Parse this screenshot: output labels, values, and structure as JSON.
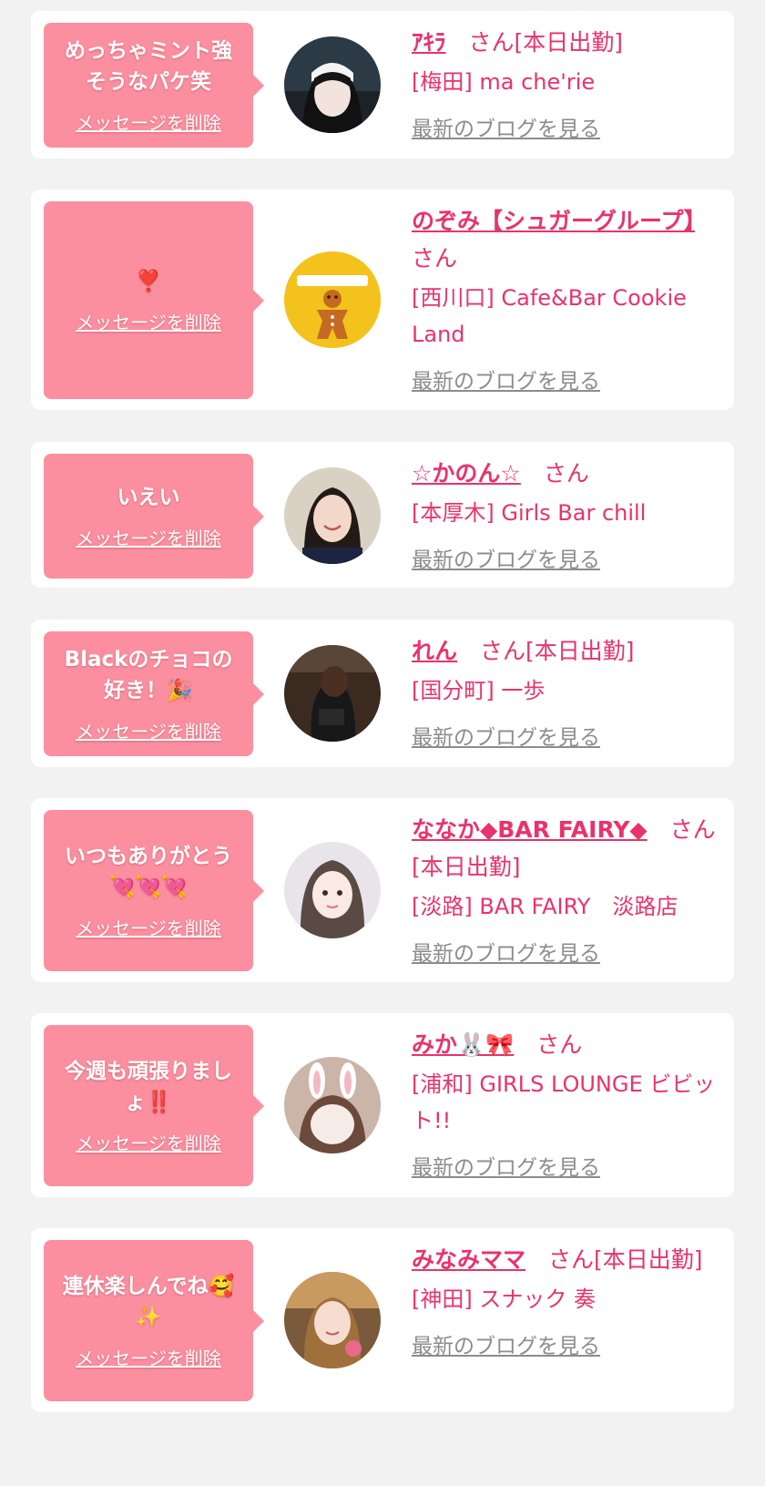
{
  "colors": {
    "background": "#f2f2f2",
    "card": "#ffffff",
    "bubble": "#fb8f9f",
    "accent": "#e8336b",
    "muted": "#8c8c8c"
  },
  "labels": {
    "delete": "メッセージを削除",
    "blog": "最新のブログを見る"
  },
  "entries": [
    {
      "message": "めっちゃミント強\nそうなパケ笑",
      "name": "ｱｷﾗ",
      "suffix": "　さん[本日出勤]",
      "shop": "[梅田] ma che'rie",
      "avatar": "maid-headband-photo"
    },
    {
      "message": "❣️",
      "name": "のぞみ【シュガーグループ】",
      "suffix": "　さん",
      "shop": "[西川口] Cafe&Bar Cookie Land",
      "avatar": "gingerbread-photo-coming-soon"
    },
    {
      "message": "いえい",
      "name": "☆かのん☆",
      "suffix": "　さん",
      "shop": "[本厚木] Girls Bar chill",
      "avatar": "smiling-portrait-photo"
    },
    {
      "message": "Blackのチョコの\n好き！🎉",
      "name": "れん",
      "suffix": "　さん[本日出勤]",
      "shop": "[国分町] 一歩",
      "avatar": "back-view-photo"
    },
    {
      "message": "いつもありがとう\n💘💘💘",
      "name": "ななか◆BAR FAIRY◆",
      "suffix": "　さん[本日出勤]",
      "shop": "[淡路] BAR FAIRY　淡路店",
      "avatar": "braided-hair-photo"
    },
    {
      "message": "今週も頑張りまし\nょ‼️",
      "name": "みか🐰🎀",
      "suffix": "　さん",
      "shop": "[浦和] GIRLS LOUNGE ビビット!!",
      "avatar": "bunny-ears-photo"
    },
    {
      "message": "連休楽しんでね🥰\n✨",
      "name": "みなみママ",
      "suffix": "　さん[本日出勤]",
      "shop": "[神田] スナック 奏",
      "avatar": "mama-portrait-photo"
    }
  ]
}
